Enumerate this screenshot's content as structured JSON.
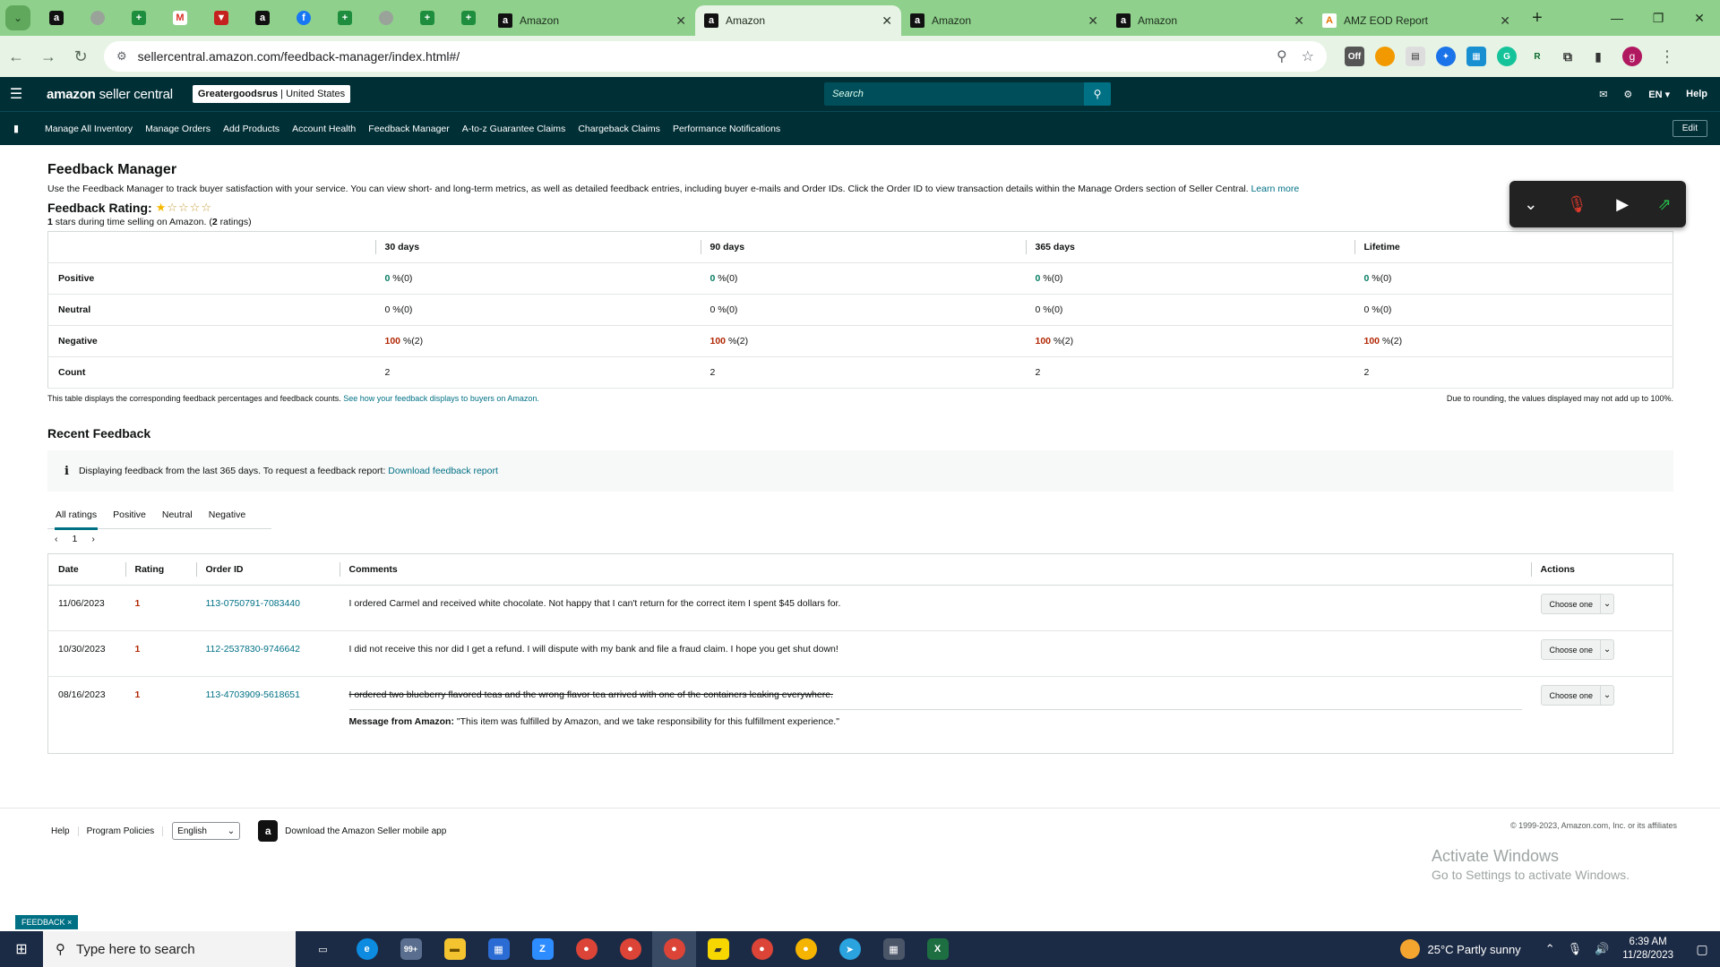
{
  "browser": {
    "tabs": [
      {
        "title": "Amazon",
        "active": false
      },
      {
        "title": "Amazon",
        "active": true
      },
      {
        "title": "Amazon",
        "active": false
      },
      {
        "title": "Amazon",
        "active": false
      },
      {
        "title": "AMZ EOD Report",
        "active": false
      }
    ],
    "url": "sellercentral.amazon.com/feedback-manager/index.html#/"
  },
  "header": {
    "logo_main": "amazon",
    "logo_sub": "seller central",
    "store_name": "Greatergoodsrus",
    "store_region": "United States",
    "search_placeholder": "Search",
    "lang": "EN",
    "help": "Help"
  },
  "nav": {
    "items": [
      "Manage All Inventory",
      "Manage Orders",
      "Add Products",
      "Account Health",
      "Feedback Manager",
      "A-to-z Guarantee Claims",
      "Chargeback Claims",
      "Performance Notifications"
    ],
    "edit": "Edit"
  },
  "page": {
    "title": "Feedback Manager",
    "intro": "Use the Feedback Manager to track buyer satisfaction with your service. You can view short- and long-term metrics, as well as detailed feedback entries, including buyer e-mails and Order IDs. Click the Order ID to view transaction details within the Manage Orders section of Seller Central.",
    "learn_more": "Learn more",
    "rating_label": "Feedback Rating:",
    "stars_filled": 1,
    "stars_total": 5,
    "rating_count_stars": "1",
    "rating_sub_mid": " stars during time selling on Amazon. (",
    "rating_count": "2",
    "rating_sub_end": " ratings)"
  },
  "metrics": {
    "columns": [
      "30 days",
      "90 days",
      "365 days",
      "Lifetime"
    ],
    "rows": [
      {
        "label": "Positive",
        "class": "g",
        "cells": [
          {
            "pct": "0",
            "cnt": " %(0)"
          },
          {
            "pct": "0",
            "cnt": " %(0)"
          },
          {
            "pct": "0",
            "cnt": " %(0)"
          },
          {
            "pct": "0",
            "cnt": " %(0)"
          }
        ]
      },
      {
        "label": "Neutral",
        "class": "",
        "cells": [
          {
            "pct": "0",
            "cnt": " %(0)"
          },
          {
            "pct": "0",
            "cnt": " %(0)"
          },
          {
            "pct": "0",
            "cnt": " %(0)"
          },
          {
            "pct": "0",
            "cnt": " %(0)"
          }
        ]
      },
      {
        "label": "Negative",
        "class": "r",
        "cells": [
          {
            "pct": "100",
            "cnt": " %(2)"
          },
          {
            "pct": "100",
            "cnt": " %(2)"
          },
          {
            "pct": "100",
            "cnt": " %(2)"
          },
          {
            "pct": "100",
            "cnt": " %(2)"
          }
        ]
      },
      {
        "label": "Count",
        "class": "",
        "cells": [
          {
            "pct": "",
            "cnt": "2"
          },
          {
            "pct": "",
            "cnt": "2"
          },
          {
            "pct": "",
            "cnt": "2"
          },
          {
            "pct": "",
            "cnt": "2"
          }
        ]
      }
    ],
    "note_left": "This table displays the corresponding feedback percentages and feedback counts.",
    "note_link": "See how your feedback displays to buyers on Amazon.",
    "note_right": "Due to rounding, the values displayed may not add up to 100%."
  },
  "recent": {
    "title": "Recent Feedback",
    "info": "Displaying feedback from the last 365 days. To request a feedback report:",
    "info_link": "Download feedback report",
    "tabs": [
      "All ratings",
      "Positive",
      "Neutral",
      "Negative"
    ],
    "page": "1",
    "columns": [
      "Date",
      "Rating",
      "Order ID",
      "Comments",
      "Actions"
    ],
    "rows": [
      {
        "date": "11/06/2023",
        "rating": "1",
        "order_id": "113-0750791-7083440",
        "comment": "I ordered Carmel and received white chocolate. Not happy that I can't return for the correct item I spent $45 dollars for.",
        "action": "Choose one"
      },
      {
        "date": "10/30/2023",
        "rating": "1",
        "order_id": "112-2537830-9746642",
        "comment": "I did not receive this nor did I get a refund. I will dispute with my bank and file a fraud claim. I hope you get shut down!",
        "action": "Choose one"
      },
      {
        "date": "08/16/2023",
        "rating": "1",
        "order_id": "113-4703909-5618651",
        "comment": "I ordered two blueberry flavored teas and the wrong flavor tea arrived with one of the containers leaking everywhere.",
        "action": "Choose one",
        "msg_label": "Message from Amazon:",
        "msg_text": " \"This item was fulfilled by Amazon, and we take responsibility for this fulfillment experience.\""
      }
    ]
  },
  "footer": {
    "help": "Help",
    "policies": "Program Policies",
    "language": "English",
    "app": "Download the Amazon Seller mobile app",
    "copyright": "© 1999-2023, Amazon.com, Inc. or its affiliates"
  },
  "watermark": {
    "line1": "Activate Windows",
    "line2": "Go to Settings to activate Windows."
  },
  "feedback_badge": "FEEDBACK ×",
  "taskbar": {
    "search": "Type here to search",
    "mail_badge": "99+",
    "weather": "25°C  Partly sunny",
    "time": "6:39 AM",
    "date": "11/28/2023"
  }
}
